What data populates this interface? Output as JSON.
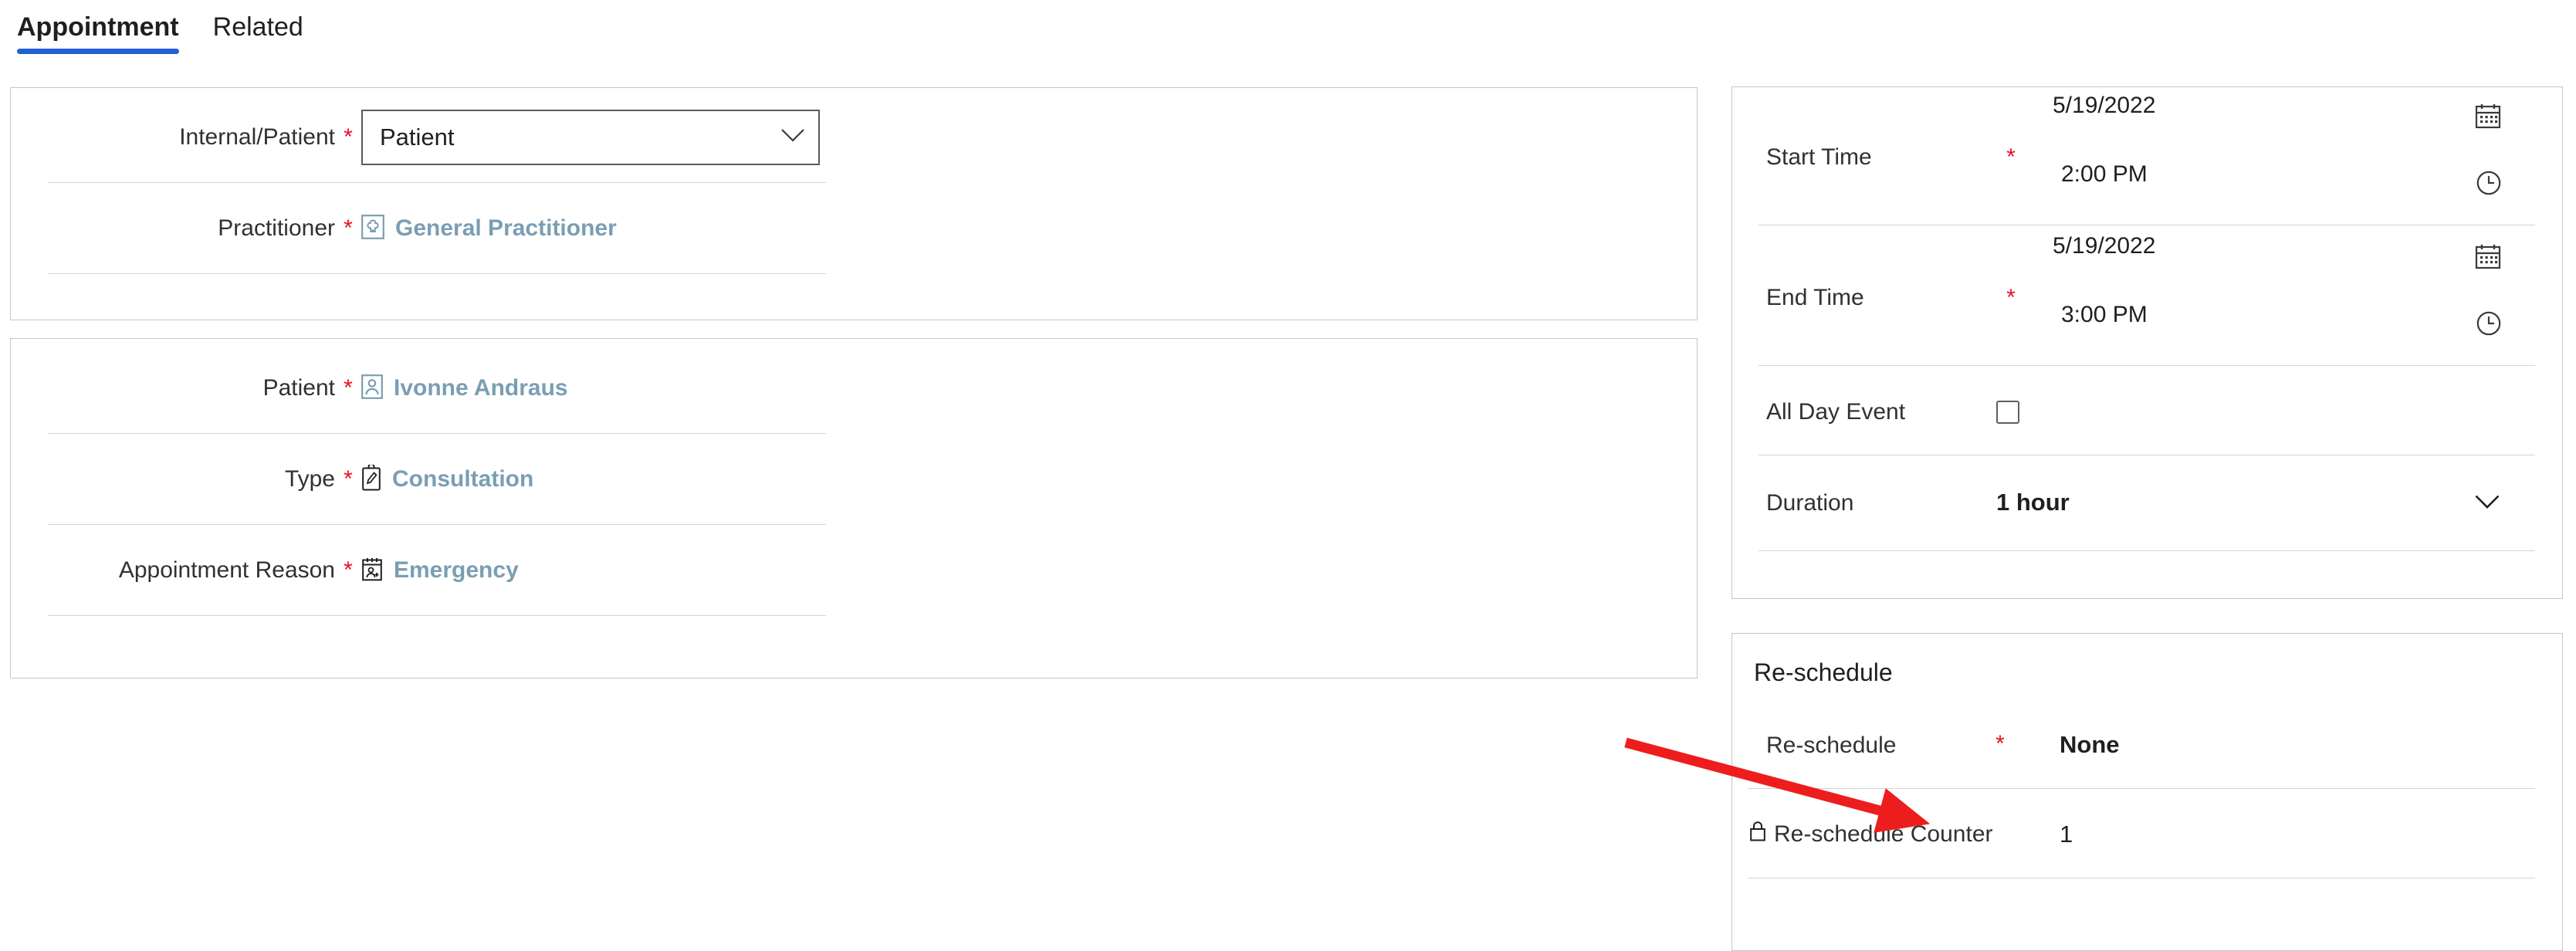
{
  "tabs": [
    {
      "label": "Appointment",
      "active": true
    },
    {
      "label": "Related",
      "active": false
    }
  ],
  "colors": {
    "tab_accent": "#2360d6",
    "required_asterisk": "#e81123",
    "lookup_link": "#7a9eb3",
    "annotation_arrow": "#ee1d1d",
    "card_border": "#c8c6c4",
    "divider": "#d6d4d2"
  },
  "internal_patient_card": {
    "rows": [
      {
        "label": "Internal/Patient",
        "required": "*",
        "control": "dropdown",
        "value": "Patient",
        "icon": "chevron-down-icon"
      },
      {
        "label": "Practitioner",
        "required": "*",
        "control": "lookup",
        "value": "General Practitioner",
        "icon": "practitioner-icon"
      }
    ]
  },
  "patient_card": {
    "rows": [
      {
        "label": "Patient",
        "required": "*",
        "control": "lookup",
        "value": "Ivonne Andraus",
        "icon": "contact-card-icon"
      },
      {
        "label": "Type",
        "required": "*",
        "control": "lookup",
        "value": "Consultation",
        "icon": "clipboard-pen-icon"
      },
      {
        "label": "Appointment Reason",
        "required": "*",
        "control": "lookup",
        "value": "Emergency",
        "icon": "calendar-person-icon"
      }
    ]
  },
  "time_card": {
    "start_time": {
      "label": "Start Time",
      "required": "*",
      "date": "5/19/2022",
      "time": "2:00 PM",
      "date_icon": "calendar-icon",
      "time_icon": "clock-icon"
    },
    "end_time": {
      "label": "End Time",
      "required": "*",
      "date": "5/19/2022",
      "time": "3:00 PM",
      "date_icon": "calendar-icon",
      "time_icon": "clock-icon"
    },
    "all_day_event": {
      "label": "All Day Event",
      "checked": false,
      "control": "checkbox"
    },
    "duration": {
      "label": "Duration",
      "value": "1 hour",
      "icon": "chevron-down-icon"
    }
  },
  "reschedule_card": {
    "title": "Re-schedule",
    "rows": [
      {
        "label": "Re-schedule",
        "required": "*",
        "value": "None",
        "locked": false
      },
      {
        "label": "Re-schedule Counter",
        "required": "",
        "value": "1",
        "locked": true,
        "icon": "lock-icon"
      }
    ]
  }
}
